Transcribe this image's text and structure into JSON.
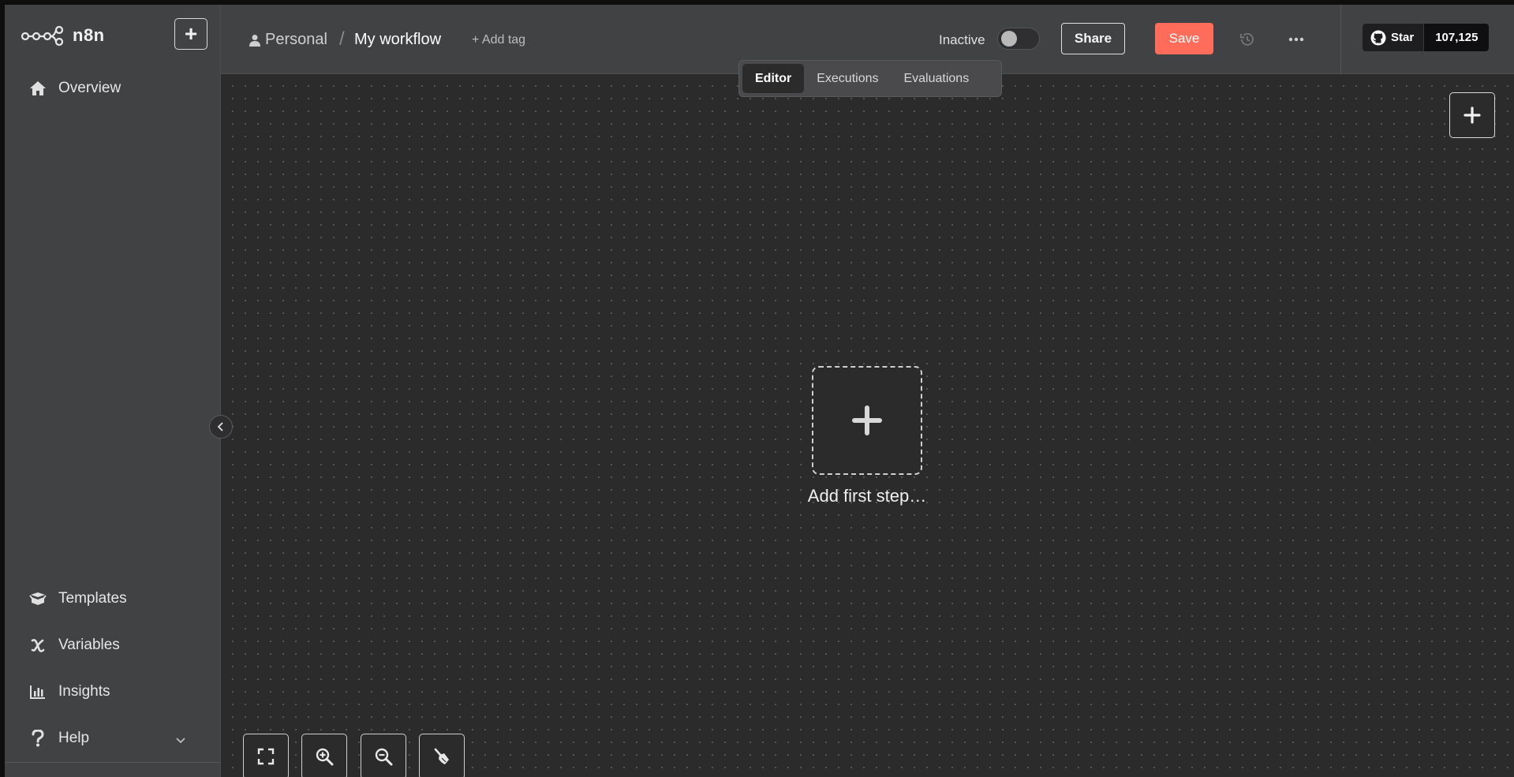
{
  "app": {
    "logo_text": "n8n"
  },
  "sidebar": {
    "new_button_label": "+",
    "items": [
      {
        "label": "Overview",
        "icon": "home-icon"
      },
      {
        "label": "Templates",
        "icon": "box-open-icon"
      },
      {
        "label": "Variables",
        "icon": "variable-icon"
      },
      {
        "label": "Insights",
        "icon": "chart-bar-icon"
      },
      {
        "label": "Help",
        "icon": "question-icon"
      }
    ]
  },
  "header": {
    "breadcrumb_project": "Personal",
    "breadcrumb_separator": "/",
    "workflow_name": "My workflow",
    "add_tag_label": "+ Add tag",
    "active_state_label": "Inactive",
    "share_label": "Share",
    "save_label": "Save",
    "github": {
      "star_label": "Star",
      "star_count": "107,125"
    }
  },
  "tabs": [
    {
      "label": "Editor",
      "active": true
    },
    {
      "label": "Executions",
      "active": false
    },
    {
      "label": "Evaluations",
      "active": false
    }
  ],
  "canvas": {
    "add_first_step_label": "Add first step…"
  },
  "colors": {
    "accent": "#ff6d5a",
    "sidebar_bg": "#414244",
    "canvas_bg": "#2b2b2b"
  }
}
